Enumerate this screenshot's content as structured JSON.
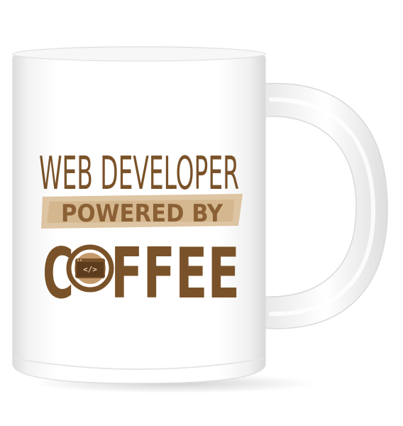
{
  "product": {
    "type": "coffee mug",
    "colors": {
      "mug": "#ffffff",
      "text_dark": "#7a5229",
      "text_light": "#d7b88f",
      "badge_bg": "#c8ab86",
      "banner_text": "#8b6035"
    }
  },
  "print": {
    "line1": "WEB DEVELOPER",
    "line2": "POWERED BY",
    "line3_prefix": "C",
    "line3_suffix": "FFEE",
    "cup_code": "</>"
  }
}
